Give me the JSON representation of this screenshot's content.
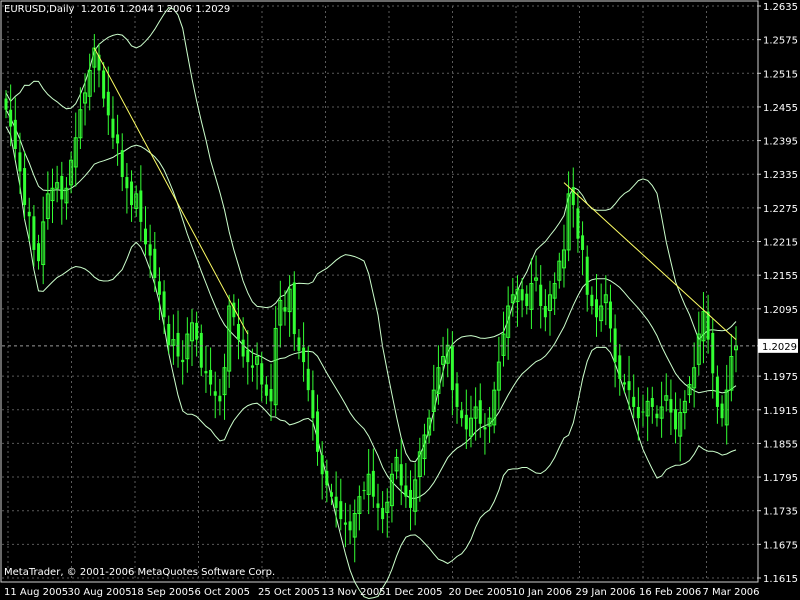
{
  "chart_data": {
    "type": "candlestick",
    "symbol": "EURUSD,Daily",
    "ohlc_header": "1.2016 1.2044 1.2006 1.2029",
    "last_price": 1.2029,
    "last_price_label": "1.2029",
    "copyright": "MetaTrader, © 2001-2006 MetaQuotes Software Corp.",
    "ylim": [
      1.1615,
      1.2635
    ],
    "y_ticks": [
      "1.2635",
      "1.2575",
      "1.2515",
      "1.2455",
      "1.2395",
      "1.2335",
      "1.2275",
      "1.2215",
      "1.2155",
      "1.2095",
      "1.2029",
      "1.1975",
      "1.1915",
      "1.1855",
      "1.1795",
      "1.1735",
      "1.1675",
      "1.1615"
    ],
    "x_ticks": [
      "11 Aug 2005",
      "30 Aug 2005",
      "18 Sep 2005",
      "6 Oct 2005",
      "25 Oct 2005",
      "13 Nov 2005",
      "1 Dec 2005",
      "20 Dec 2005",
      "10 Jan 2006",
      "29 Jan 2006",
      "16 Feb 2006",
      "7 Mar 2006"
    ],
    "grid": true,
    "colors": {
      "background": "#000000",
      "grid": "#5a5a5a",
      "candle": "#33ff33",
      "bands": "#ccffcc",
      "trendline": "#ffff66",
      "text": "#ffffff"
    },
    "close_series": [
      1.245,
      1.242,
      1.238,
      1.234,
      1.228,
      1.226,
      1.22,
      1.218,
      1.225,
      1.23,
      1.231,
      1.232,
      1.229,
      1.231,
      1.236,
      1.24,
      1.245,
      1.248,
      1.252,
      1.256,
      1.252,
      1.247,
      1.244,
      1.24,
      1.239,
      1.233,
      1.231,
      1.228,
      1.23,
      1.225,
      1.221,
      1.219,
      1.215,
      1.212,
      1.208,
      1.203,
      1.204,
      1.201,
      1.2,
      1.205,
      1.207,
      1.204,
      1.199,
      1.198,
      1.196,
      1.194,
      1.193,
      1.199,
      1.21,
      1.208,
      1.204,
      1.201,
      1.2,
      1.199,
      1.201,
      1.196,
      1.194,
      1.193,
      1.206,
      1.211,
      1.209,
      1.213,
      1.205,
      1.202,
      1.2,
      1.195,
      1.19,
      1.184,
      1.18,
      1.178,
      1.176,
      1.174,
      1.172,
      1.171,
      1.17,
      1.173,
      1.176,
      1.177,
      1.18,
      1.176,
      1.174,
      1.172,
      1.175,
      1.18,
      1.183,
      1.178,
      1.176,
      1.174,
      1.179,
      1.184,
      1.187,
      1.19,
      1.195,
      1.199,
      1.201,
      1.203,
      1.195,
      1.192,
      1.19,
      1.188,
      1.19,
      1.192,
      1.189,
      1.188,
      1.19,
      1.195,
      1.2,
      1.205,
      1.21,
      1.212,
      1.213,
      1.211,
      1.21,
      1.214,
      1.215,
      1.21,
      1.208,
      1.212,
      1.214,
      1.218,
      1.22,
      1.23,
      1.228,
      1.222,
      1.22,
      1.212,
      1.21,
      1.208,
      1.21,
      1.212,
      1.206,
      1.2,
      1.197,
      1.196,
      1.195,
      1.192,
      1.19,
      1.191,
      1.193,
      1.192,
      1.19,
      1.192,
      1.194,
      1.191,
      1.188,
      1.191,
      1.193,
      1.196,
      1.199,
      1.205,
      1.209,
      1.204,
      1.198,
      1.192,
      1.19,
      1.195,
      1.201,
      1.2029
    ]
  }
}
